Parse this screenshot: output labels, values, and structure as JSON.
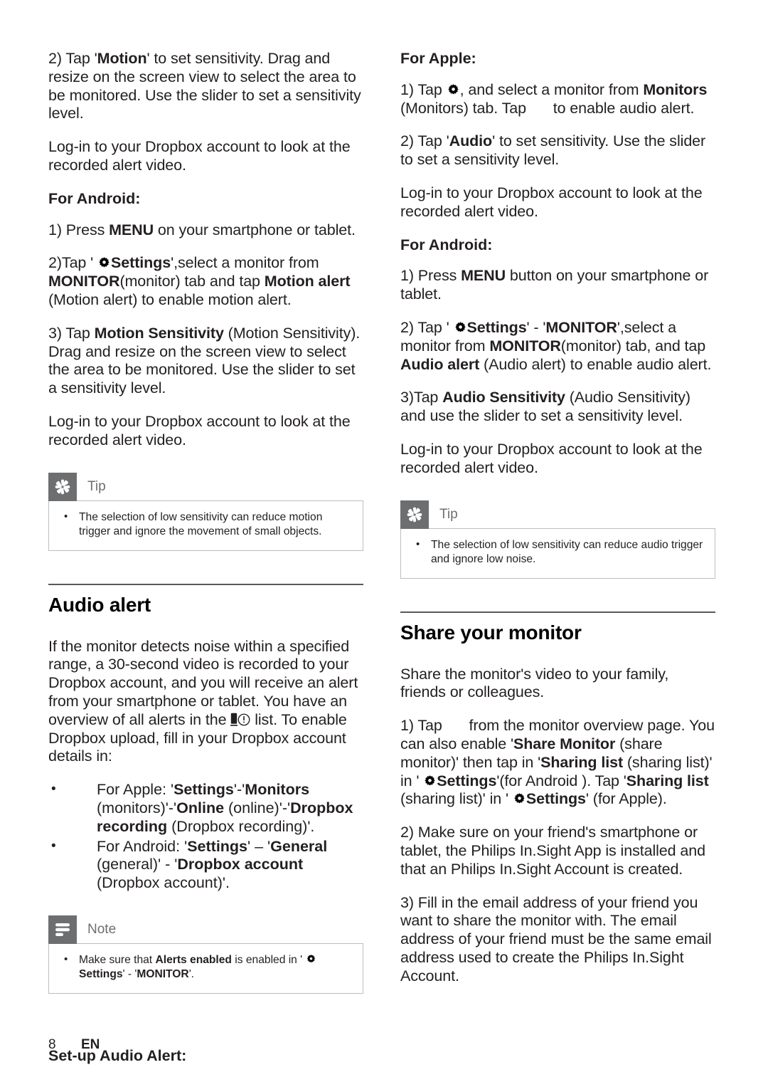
{
  "document": {
    "footer": {
      "page_number": "8",
      "language": "EN"
    }
  },
  "left_column": {
    "para_motion_step2": {
      "prefix": "2) Tap '",
      "bold1": "Motion",
      "rest": "' to set sensitivity. Drag and resize on the screen view to select the area to be monitored. Use the slider to set a sensitivity level."
    },
    "para_dropbox_login_1": "Log-in to your Dropbox account to look at the recorded alert video.",
    "heading_for_android": "For Android:",
    "android_step1": {
      "prefix": "1) Press ",
      "bold1": "MENU",
      "rest": " on your smartphone or tablet."
    },
    "android_step2": {
      "prefix": "2)Tap ' ",
      "icon": "gear-icon",
      "bold1": "Settings",
      "mid1": "',select a monitor from ",
      "bold2": "MONITOR",
      "mid2": "(monitor) tab and tap ",
      "bold3": "Motion alert",
      "rest": " (Motion alert) to enable motion alert."
    },
    "android_step3": {
      "prefix": "3) Tap ",
      "bold1": "Motion Sensitivity",
      "rest": " (Motion Sensitivity). Drag and resize on the screen view to select the area to be monitored. Use the slider to set a sensitivity level."
    },
    "para_dropbox_login_2": "Log-in to your Dropbox account to look at the recorded alert video.",
    "tip_box": {
      "icon": "asterisk-icon",
      "title": "Tip",
      "items": [
        "The selection of low sensitivity can reduce motion trigger and ignore the movement of small objects."
      ]
    },
    "audio_alert_section": {
      "title": "Audio alert",
      "intro": {
        "part1": "If the monitor detects noise within a specified range, a 30-second video is recorded to your Dropbox account, and you will receive an alert from your smartphone or tablet. You have an overview of all alerts in the ",
        "icon1": "device-icon",
        "icon2": "alert-circle-icon",
        "part2": " list. To enable Dropbox upload, fill in your Dropbox account details in:"
      },
      "bullets": [
        {
          "prefix": "For Apple:  '",
          "bold1": "Settings",
          "mid1": "'-'",
          "bold2": "Monitors",
          "mid2": " (monitors)'-'",
          "bold3": "Online",
          "mid3": " (online)'-'",
          "bold4": "Dropbox recording",
          "rest": " (Dropbox recording)'."
        },
        {
          "prefix": "For Android: '",
          "bold1": "Settings",
          "mid1": "' – '",
          "bold2": "General",
          "mid2": " (general)' - '",
          "bold3": "Dropbox account",
          "rest": " (Dropbox account)'."
        }
      ],
      "note_box": {
        "icon": "note-lines-icon",
        "title": "Note",
        "item": {
          "prefix": "Make sure that ",
          "bold1": "Alerts enabled",
          "mid1": " is enabled in ' ",
          "icon": "gear-icon",
          "bold2": "Settings",
          "mid2": "' - '",
          "bold3": "MONITOR",
          "rest": "'."
        }
      },
      "setup_label": "Set-up Audio Alert:"
    }
  },
  "right_column": {
    "heading_for_apple": "For Apple:",
    "apple_step1": {
      "prefix": "1) Tap ",
      "icon": "gear-icon",
      "mid1": ", and select a monitor from ",
      "bold1": "Monitors",
      "mid2": " (Monitors) tab. Tap ",
      "rest": " to enable audio alert."
    },
    "apple_step2": {
      "prefix": "2) Tap '",
      "bold1": "Audio",
      "rest": "' to set sensitivity. Use the slider to set a sensitivity level."
    },
    "para_dropbox_login_1": "Log-in to your Dropbox account to look at the recorded alert video.",
    "heading_for_android": "For Android:",
    "android_step1": {
      "prefix": "1) Press ",
      "bold1": "MENU",
      "rest": " button on your smartphone or tablet."
    },
    "android_step2": {
      "prefix": "2) Tap ' ",
      "icon": "gear-icon",
      "bold1": "Settings",
      "mid1": "' - '",
      "bold2": "MONITOR",
      "mid2": "',select a monitor from ",
      "bold3": "MONITOR",
      "mid3": "(monitor) tab, and tap ",
      "bold4": "Audio alert",
      "rest": " (Audio alert) to enable audio alert."
    },
    "android_step3": {
      "prefix": "3)Tap ",
      "bold1": "Audio Sensitivity",
      "rest": " (Audio Sensitivity) and use the slider to set a sensitivity level."
    },
    "para_dropbox_login_2": "Log-in to your Dropbox account to look at the recorded alert video.",
    "tip_box": {
      "icon": "asterisk-icon",
      "title": "Tip",
      "items": [
        "The selection of low sensitivity can reduce audio trigger and ignore low noise."
      ]
    },
    "share_section": {
      "title": "Share your monitor",
      "intro": "Share the monitor's video to your family, friends or colleagues.",
      "step1": {
        "prefix": "1) Tap ",
        "mid0": " from the monitor overview page. You can also enable '",
        "bold1": "Share Monitor",
        "mid1": " (share monitor)' then tap in '",
        "bold2": "Sharing list",
        "mid2": " (sharing list)' in ' ",
        "icon": "gear-icon",
        "bold3": "Settings",
        "mid3": "'(for Android ). Tap '",
        "bold4": "Sharing list",
        "mid4": " (sharing list)' in ' ",
        "icon2": "gear-icon",
        "bold5": "Settings",
        "rest": "' (for Apple)."
      },
      "step2": "2) Make sure on your friend's smartphone or tablet, the Philips In.Sight App is installed and that an Philips In.Sight Account is created.",
      "step3": "3) Fill in the email address of your friend you want to share the monitor with. The email address of your friend must be the same email address used to create the Philips In.Sight Account."
    }
  },
  "colors": {
    "text": "#231f20",
    "badge_gray": "#6d6e70",
    "rule_gray": "#58595b",
    "box_border": "#bcbec0"
  }
}
